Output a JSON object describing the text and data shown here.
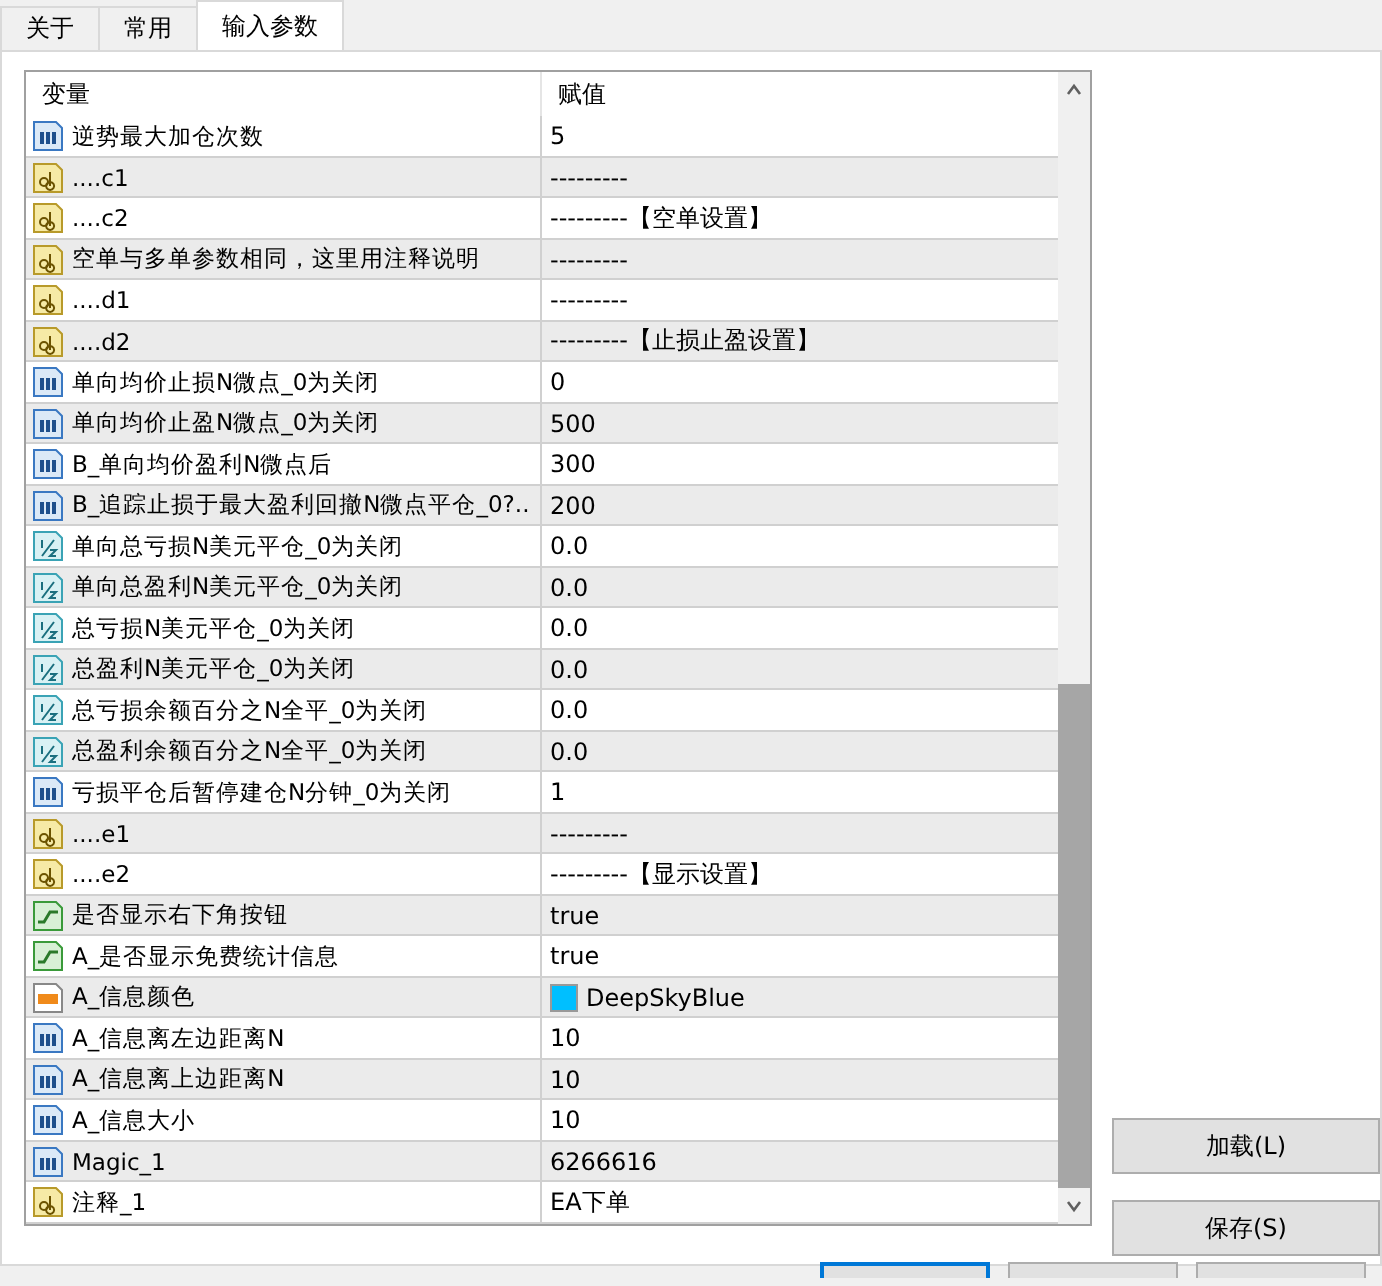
{
  "tabs": [
    {
      "label": "关于",
      "selected": false
    },
    {
      "label": "常用",
      "selected": false
    },
    {
      "label": "输入参数",
      "selected": true
    }
  ],
  "table": {
    "columns": [
      "变量",
      "赋值"
    ],
    "rows": [
      {
        "kind": "int",
        "name": "逆势最大加仓次数",
        "value": "5"
      },
      {
        "kind": "string",
        "name": "....c1",
        "value": "---------"
      },
      {
        "kind": "string",
        "name": "....c2",
        "value": "---------【空单设置】"
      },
      {
        "kind": "string",
        "name": "空单与多单参数相同，这里用注释说明",
        "value": "---------"
      },
      {
        "kind": "string",
        "name": "....d1",
        "value": "---------"
      },
      {
        "kind": "string",
        "name": "....d2",
        "value": "---------【止损止盈设置】"
      },
      {
        "kind": "int",
        "name": "单向均价止损N微点_0为关闭",
        "value": "0"
      },
      {
        "kind": "int",
        "name": "单向均价止盈N微点_0为关闭",
        "value": "500"
      },
      {
        "kind": "int",
        "name": "B_单向均价盈利N微点后",
        "value": "300"
      },
      {
        "kind": "int",
        "name": "B_追踪止损于最大盈利回撤N微点平仓_0?..",
        "value": "200"
      },
      {
        "kind": "double",
        "name": "单向总亏损N美元平仓_0为关闭",
        "value": "0.0"
      },
      {
        "kind": "double",
        "name": "单向总盈利N美元平仓_0为关闭",
        "value": "0.0"
      },
      {
        "kind": "double",
        "name": "总亏损N美元平仓_0为关闭",
        "value": "0.0"
      },
      {
        "kind": "double",
        "name": "总盈利N美元平仓_0为关闭",
        "value": "0.0"
      },
      {
        "kind": "double",
        "name": "总亏损余额百分之N全平_0为关闭",
        "value": "0.0"
      },
      {
        "kind": "double",
        "name": "总盈利余额百分之N全平_0为关闭",
        "value": "0.0"
      },
      {
        "kind": "int",
        "name": "亏损平仓后暂停建仓N分钟_0为关闭",
        "value": "1"
      },
      {
        "kind": "string",
        "name": "....e1",
        "value": "---------"
      },
      {
        "kind": "string",
        "name": "....e2",
        "value": "---------【显示设置】"
      },
      {
        "kind": "bool",
        "name": "是否显示右下角按钮",
        "value": "true"
      },
      {
        "kind": "bool",
        "name": "A_是否显示免费统计信息",
        "value": "true"
      },
      {
        "kind": "color",
        "name": "A_信息颜色",
        "value": "DeepSkyBlue",
        "color": "#00bfff"
      },
      {
        "kind": "int",
        "name": "A_信息离左边距离N",
        "value": "10"
      },
      {
        "kind": "int",
        "name": "A_信息离上边距离N",
        "value": "10"
      },
      {
        "kind": "int",
        "name": "A_信息大小",
        "value": "10"
      },
      {
        "kind": "int",
        "name": "Magic_1",
        "value": "6266616"
      },
      {
        "kind": "string",
        "name": "注释_1",
        "value": "EA下单"
      }
    ]
  },
  "side_buttons": [
    "加载(L)",
    "保存(S)"
  ]
}
